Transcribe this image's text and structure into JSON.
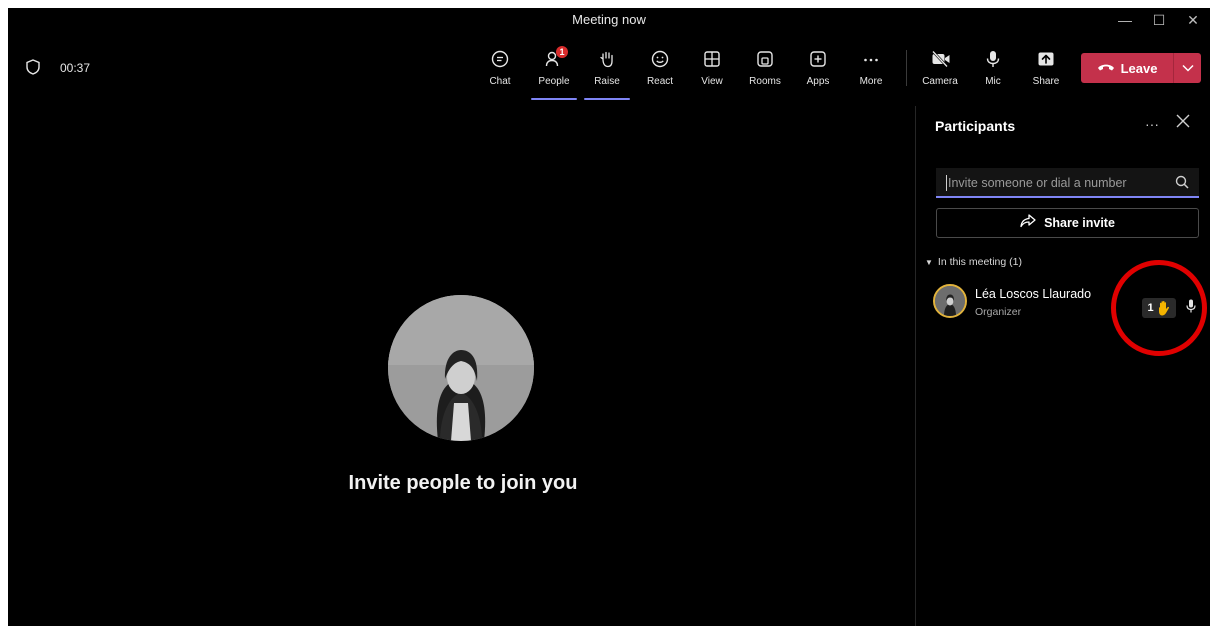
{
  "window": {
    "title": "Meeting now",
    "controls": {
      "minimize": "—",
      "maximize": "☐",
      "close": "✕"
    }
  },
  "toolbar": {
    "timer": "00:37",
    "items": [
      {
        "label": "Chat",
        "icon": "chat-icon"
      },
      {
        "label": "People",
        "icon": "people-icon",
        "badge": "1",
        "active": true
      },
      {
        "label": "Raise",
        "icon": "raise-hand-icon",
        "active": true
      },
      {
        "label": "React",
        "icon": "react-icon"
      },
      {
        "label": "View",
        "icon": "view-icon"
      },
      {
        "label": "Rooms",
        "icon": "rooms-icon"
      },
      {
        "label": "Apps",
        "icon": "apps-icon"
      },
      {
        "label": "More",
        "icon": "more-icon"
      },
      {
        "label": "Camera",
        "icon": "camera-off-icon"
      },
      {
        "label": "Mic",
        "icon": "mic-icon"
      },
      {
        "label": "Share",
        "icon": "share-icon"
      }
    ],
    "leave_label": "Leave"
  },
  "stage": {
    "invite_text": "Invite people to join you"
  },
  "panel": {
    "title": "Participants",
    "more": "···",
    "search_placeholder": "Invite someone or dial a number",
    "share_invite_label": "Share invite",
    "section_label": "In this meeting (1)",
    "participants": [
      {
        "name": "Léa Loscos Llaurado",
        "role": "Organizer",
        "raised_hand_count": "1"
      }
    ]
  },
  "colors": {
    "accent": "#7f85f5",
    "leave": "#c4314b",
    "badge": "#d92c2c",
    "annotation": "#e00000",
    "raised_hand": "#f4b400"
  }
}
